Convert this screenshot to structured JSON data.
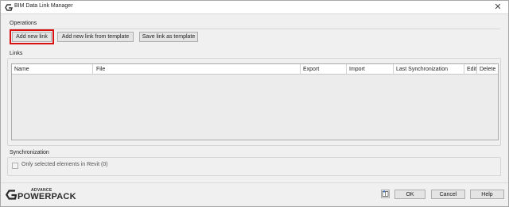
{
  "window": {
    "title": "BIM Data Link Manager",
    "close_glyph": "✕"
  },
  "operations": {
    "group_label": "Operations",
    "buttons": [
      {
        "label": "Add new link",
        "highlighted": true
      },
      {
        "label": "Add new link from template",
        "highlighted": false
      },
      {
        "label": "Save link as template",
        "highlighted": false
      }
    ]
  },
  "links": {
    "group_label": "Links",
    "columns": [
      "Name",
      "File",
      "Export",
      "Import",
      "Last Synchronization",
      "Edit",
      "Delete"
    ],
    "rows": []
  },
  "synchronization": {
    "group_label": "Synchronization",
    "checkbox_label": "Only selected elements in Revit (0)",
    "checkbox_checked": false,
    "checkbox_enabled": false
  },
  "footer": {
    "logo_small": "ADVANCE",
    "logo_big": "POWERPACK",
    "icon_button": "book-icon",
    "ok_label": "OK",
    "cancel_label": "Cancel",
    "help_label": "Help"
  },
  "colors": {
    "highlight": "#d81010",
    "window_bg": "#f0f0f0",
    "table_bg": "#ececec"
  }
}
